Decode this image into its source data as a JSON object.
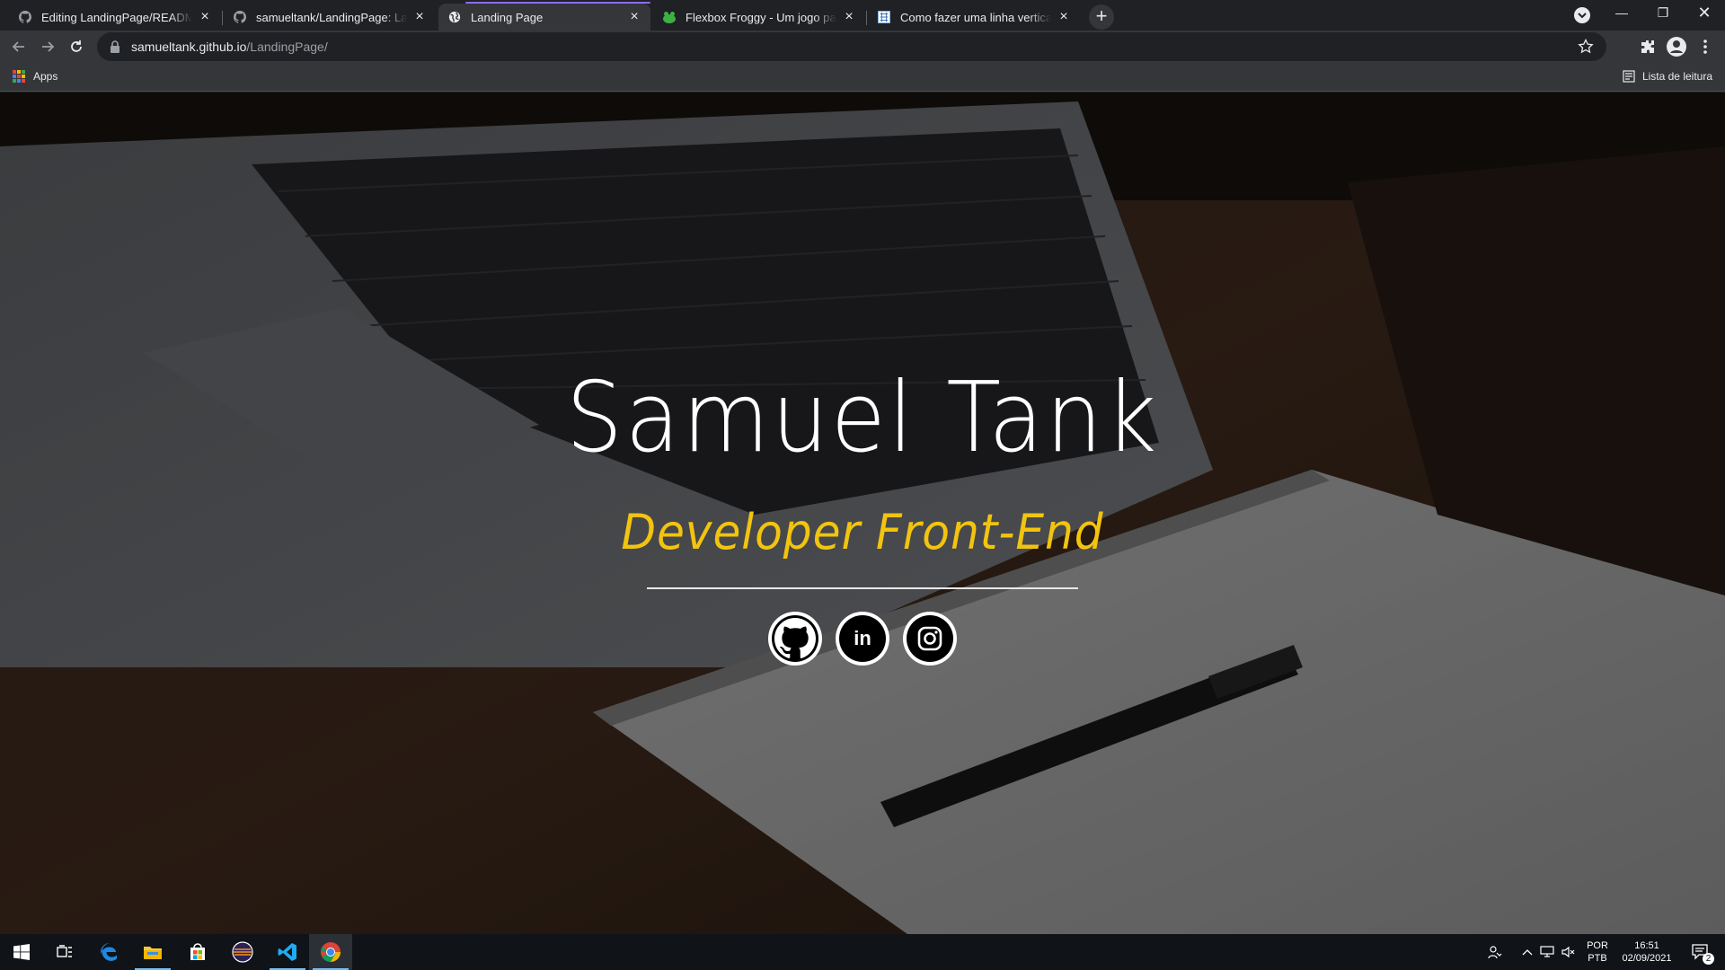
{
  "browser": {
    "tabs": [
      {
        "title": "Editing LandingPage/README.md",
        "icon": "github-icon",
        "active": false
      },
      {
        "title": "samueltank/LandingPage: Landing Page",
        "icon": "github-icon",
        "active": false
      },
      {
        "title": "Landing Page",
        "icon": "globe-icon",
        "active": true
      },
      {
        "title": "Flexbox Froggy - Um jogo para aprender",
        "icon": "frog-icon",
        "active": false
      },
      {
        "title": "Como fazer uma linha vertical com CSS",
        "icon": "stackoverflow-icon",
        "active": false
      }
    ],
    "new_tab_label": "+",
    "address": {
      "host": "samueltank.github.io",
      "path": "/LandingPage/"
    },
    "bookmarks": {
      "apps_label": "Apps",
      "reading_list_label": "Lista de leitura"
    }
  },
  "page": {
    "name": "Samuel Tank",
    "role": "Developer Front-End",
    "socials": [
      {
        "name": "github",
        "icon": "github-icon"
      },
      {
        "name": "linkedin",
        "icon": "linkedin-icon",
        "label": "in"
      },
      {
        "name": "instagram",
        "icon": "instagram-icon"
      }
    ],
    "colors": {
      "role_accent": "#f2c40f",
      "name": "#ffffff"
    }
  },
  "taskbar": {
    "apps": [
      "windows-start-icon",
      "task-view-icon",
      "edge-icon",
      "file-explorer-icon",
      "store-icon",
      "eclipse-icon",
      "vscode-icon",
      "chrome-icon"
    ],
    "language": {
      "line1": "POR",
      "line2": "PTB"
    },
    "clock": {
      "time": "16:51",
      "date": "02/09/2021"
    },
    "notifications_count": "2"
  }
}
